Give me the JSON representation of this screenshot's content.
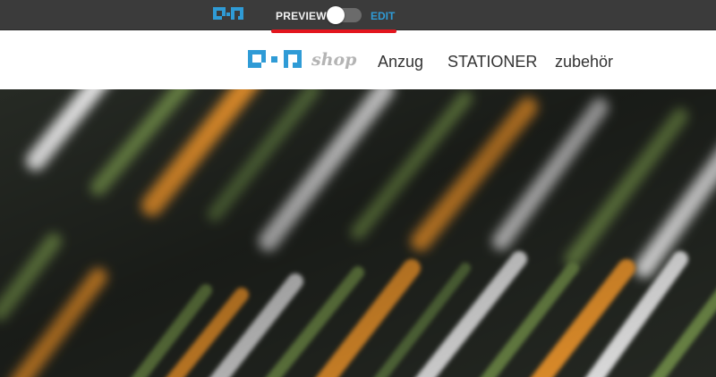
{
  "editor_bar": {
    "logo_icon": "qr-logo-icon",
    "preview_label": "PREVIEW",
    "edit_label": "EDIT",
    "toggle_state": "preview"
  },
  "header": {
    "logo_text": "shop",
    "nav": [
      {
        "label": "Anzug"
      },
      {
        "label": "STATIONER"
      },
      {
        "label": "zubehör"
      }
    ]
  },
  "colors": {
    "editor_bar_bg": "#3b3b3b",
    "accent_blue": "#2f9bd6",
    "highlight_red": "#e3161e",
    "stripe_orange": "#f39a2e",
    "stripe_green": "#7d9a55",
    "stripe_white": "#eeeeee"
  },
  "hero": {
    "image": "striped-tie-fabric-image"
  }
}
